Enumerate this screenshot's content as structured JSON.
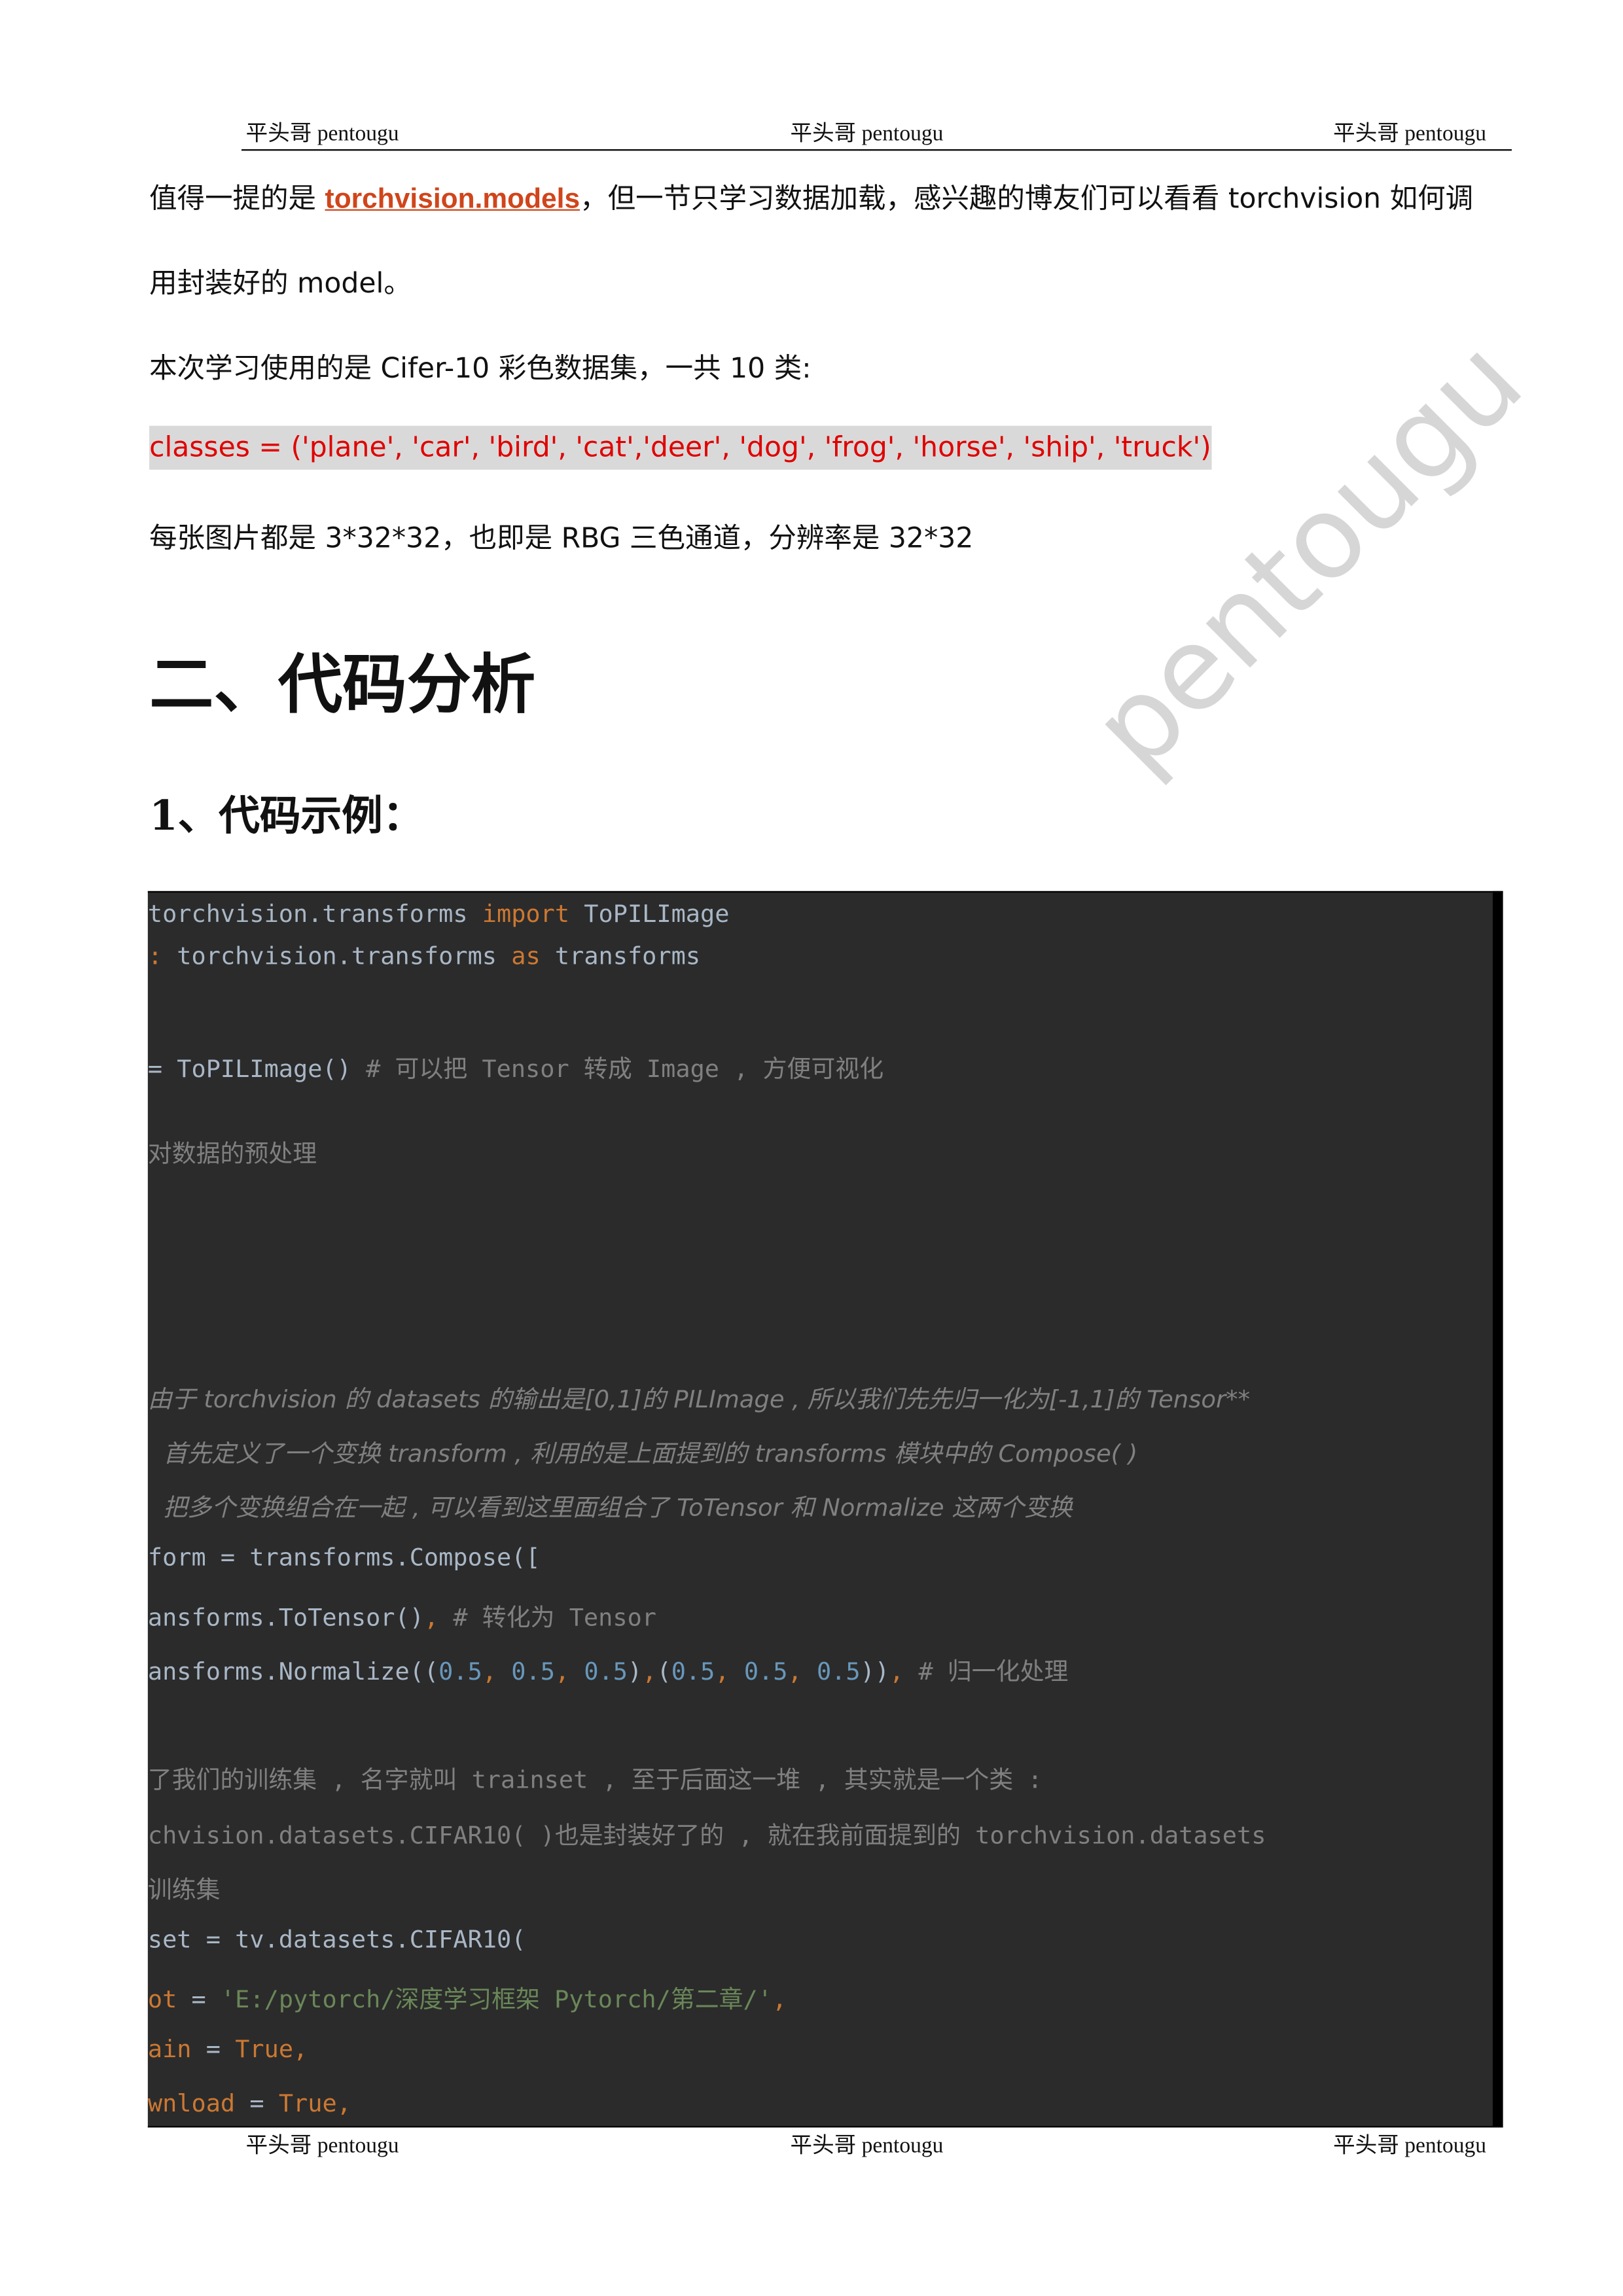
{
  "header": {
    "left": "平头哥 pentougu",
    "center": "平头哥 pentougu",
    "right": "平头哥 pentougu"
  },
  "footer": {
    "left": "平头哥 pentougu",
    "center": "平头哥 pentougu",
    "right": "平头哥 pentougu"
  },
  "watermark": "pentougu",
  "body": {
    "p1_pre": "值得一提的是 ",
    "p1_link": "torchvision.models",
    "p1_post": "，但一节只学习数据加载，感兴趣的博友们可以看看 torchvision 如何调",
    "p2": "用封装好的 model。",
    "p3": "本次学习使用的是 Cifer-10 彩色数据集，一共 10 类:",
    "p4_code": "classes = ('plane', 'car', 'bird', 'cat','deer', 'dog', 'frog', 'horse', 'ship', 'truck')",
    "p5": "每张图片都是 3*32*32，也即是 RBG 三色通道，分辨率是 32*32"
  },
  "heading1": "二、代码分析",
  "heading2": "1、代码示例：",
  "colors": {
    "bg": "#2b2b2b",
    "text": "#a9b7c6",
    "keyword": "#cc7832",
    "comment": "#808080",
    "number": "#6897bb",
    "string": "#6a8759",
    "link": "#d0451b",
    "highlight": "#e00000"
  },
  "code_lines": [
    {
      "segs": [
        [
          "t",
          "torchvision.transforms "
        ],
        [
          "k",
          "import"
        ],
        [
          "t",
          " ToPILImage"
        ]
      ]
    },
    {
      "segs": [
        [
          "k",
          ": "
        ],
        [
          "t",
          "torchvision.transforms "
        ],
        [
          "k",
          "as"
        ],
        [
          "t",
          " transforms"
        ]
      ]
    },
    {
      "segs": [
        [
          "t",
          "= ToPILImage() "
        ],
        [
          "c",
          "# 可以把 Tensor 转成 Image , 方便可视化"
        ]
      ]
    },
    {
      "segs": [
        [
          "c",
          "对数据的预处理"
        ]
      ]
    },
    {
      "italic": true,
      "segs": [
        [
          "c",
          "由于 torchvision 的 datasets 的输出是[0,1]的 PILImage , 所以我们先先归一化为[-1,1]的 Tensor**"
        ]
      ]
    },
    {
      "italic": true,
      "segs": [
        [
          "c",
          "  首先定义了一个变换 transform , 利用的是上面提到的 transforms 模块中的 Compose( )"
        ]
      ]
    },
    {
      "italic": true,
      "segs": [
        [
          "c",
          "  把多个变换组合在一起 , 可以看到这里面组合了 ToTensor 和 Normalize 这两个变换"
        ]
      ]
    },
    {
      "segs": [
        [
          "t",
          "form = transforms.Compose(["
        ]
      ]
    },
    {
      "segs": [
        [
          "t",
          "ansforms.ToTensor()"
        ],
        [
          "k",
          ","
        ],
        [
          "c",
          " # 转化为 Tensor"
        ]
      ]
    },
    {
      "segs": [
        [
          "t",
          "ansforms.Normalize(("
        ],
        [
          "n",
          "0.5"
        ],
        [
          "k",
          ", "
        ],
        [
          "n",
          "0.5"
        ],
        [
          "k",
          ", "
        ],
        [
          "n",
          "0.5"
        ],
        [
          "t",
          ")"
        ],
        [
          "k",
          ","
        ],
        [
          "t",
          "("
        ],
        [
          "n",
          "0.5"
        ],
        [
          "k",
          ", "
        ],
        [
          "n",
          "0.5"
        ],
        [
          "k",
          ", "
        ],
        [
          "n",
          "0.5"
        ],
        [
          "t",
          "))"
        ],
        [
          "k",
          ","
        ],
        [
          "c",
          " # 归一化处理"
        ]
      ]
    },
    {
      "segs": [
        [
          "c",
          "了我们的训练集 , 名字就叫 trainset , 至于后面这一堆 , 其实就是一个类 :"
        ]
      ]
    },
    {
      "segs": [
        [
          "c",
          "chvision.datasets.CIFAR10( )也是封装好了的 , 就在我前面提到的 torchvision.datasets"
        ]
      ]
    },
    {
      "segs": [
        [
          "c",
          "训练集"
        ]
      ]
    },
    {
      "segs": [
        [
          "t",
          "set = tv.datasets.CIFAR10("
        ]
      ]
    },
    {
      "segs": [
        [
          "k",
          "ot"
        ],
        [
          "t",
          " = "
        ],
        [
          "s",
          "'E:/pytorch/深度学习框架 Pytorch/第二章/'"
        ],
        [
          "k",
          ","
        ]
      ]
    },
    {
      "segs": [
        [
          "k",
          "ain"
        ],
        [
          "t",
          " = "
        ],
        [
          "k",
          "True,"
        ]
      ]
    },
    {
      "segs": [
        [
          "k",
          "wnload"
        ],
        [
          "t",
          " = "
        ],
        [
          "k",
          "True,"
        ]
      ]
    }
  ]
}
